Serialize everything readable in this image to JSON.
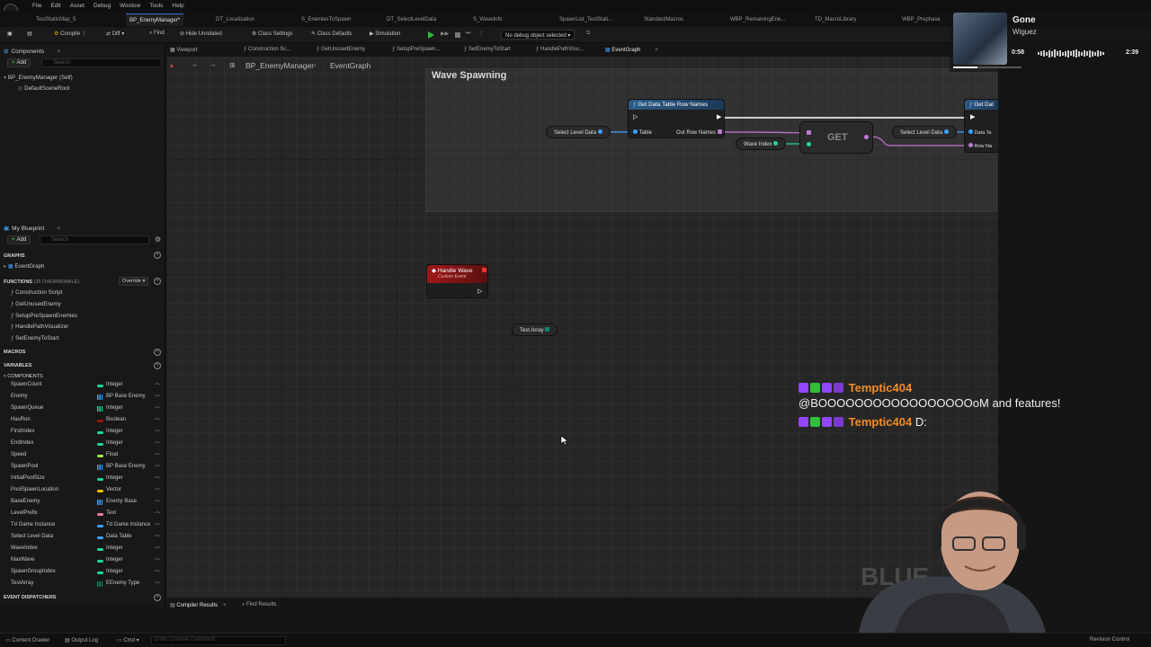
{
  "menu": [
    "File",
    "Edit",
    "Asset",
    "Debug",
    "Window",
    "Tools",
    "Help"
  ],
  "doc_tabs": [
    {
      "label": "TestStaticMap_5",
      "active": false
    },
    {
      "label": "BP_EnemyManager*",
      "active": true
    },
    {
      "label": "DT_Localization",
      "active": false
    },
    {
      "label": "S_EnemiesToSpawn",
      "active": false
    },
    {
      "label": "DT_SelectLevelData",
      "active": false
    },
    {
      "label": "S_WaveInfo",
      "active": false
    },
    {
      "label": "SpawnList_TestStati...",
      "active": false
    },
    {
      "label": "StandardMacros",
      "active": false
    },
    {
      "label": "WBP_RemainingEne...",
      "active": false
    },
    {
      "label": "TD_MacroLibrary",
      "active": false
    },
    {
      "label": "WBP_Prephase",
      "active": false
    }
  ],
  "toolbar": {
    "compile": "Compile",
    "diff": "Diff",
    "find": "Find",
    "hide_unrelated": "Hide Unrelated",
    "class_settings": "Class Settings",
    "class_defaults": "Class Defaults",
    "simulation": "Simulation",
    "debug_object": "No debug object selected"
  },
  "components_panel": {
    "tab": "Components",
    "add": "Add",
    "search_placeholder": "Search",
    "root": "BP_EnemyManager (Self)",
    "child": "DefaultSceneRoot"
  },
  "my_blueprint": {
    "tab": "My Blueprint",
    "add": "Add",
    "search_placeholder": "Search",
    "graphs_header": "Graphs",
    "event_graph": "EventGraph",
    "functions_header": "Functions",
    "functions_count": "(25 OVERRIDABLE)",
    "override": "Override",
    "functions": [
      "Construction Script",
      "GetUnusedEnemy",
      "SetupPreSpawnEnemies",
      "HandlePathVisualizer",
      "SetEnemyToStart"
    ],
    "macros_header": "Macros",
    "variables_header": "Variables",
    "components_header": "Components",
    "dispatchers_header": "Event Dispatchers",
    "variables": [
      {
        "name": "SpawnCount",
        "type": "Integer",
        "color": "#1fd6a0",
        "array": false
      },
      {
        "name": "Enemy",
        "type": "BP Base Enemy",
        "color": "#3aa2ff",
        "array": true
      },
      {
        "name": "SpawnQueue",
        "type": "Integer",
        "color": "#1fd6a0",
        "array": true
      },
      {
        "name": "HasRun",
        "type": "Boolean",
        "color": "#a01010",
        "array": false
      },
      {
        "name": "FirstIndex",
        "type": "Integer",
        "color": "#1fd6a0",
        "array": false
      },
      {
        "name": "EndIndex",
        "type": "Integer",
        "color": "#1fd6a0",
        "array": false
      },
      {
        "name": "Speed",
        "type": "Float",
        "color": "#9aef4a",
        "array": false
      },
      {
        "name": "SpawnPool",
        "type": "BP Base Enemy",
        "color": "#3aa2ff",
        "array": true
      },
      {
        "name": "InitialPoolSize",
        "type": "Integer",
        "color": "#1fd6a0",
        "array": false
      },
      {
        "name": "PoolSpawnLocation",
        "type": "Vector",
        "color": "#f5c300",
        "array": false
      },
      {
        "name": "BaseEnemy",
        "type": "Enemy Base",
        "color": "#3aa2ff",
        "array": true
      },
      {
        "name": "LevelPrefix",
        "type": "Text",
        "color": "#e87aa8",
        "array": false
      },
      {
        "name": "Td Game Instance",
        "type": "Td Game Instance",
        "color": "#3aa2ff",
        "array": false
      },
      {
        "name": "Select Level Data",
        "type": "Data Table",
        "color": "#3aa2ff",
        "array": false
      },
      {
        "name": "WaveIndex",
        "type": "Integer",
        "color": "#1fd6a0",
        "array": false
      },
      {
        "name": "MaxWave",
        "type": "Integer",
        "color": "#1fd6a0",
        "array": false
      },
      {
        "name": "SpawnGroupIndex",
        "type": "Integer",
        "color": "#1fd6a0",
        "array": false
      },
      {
        "name": "TestArray",
        "type": "EEnemy Type",
        "color": "#0a8a6a",
        "array": true
      }
    ]
  },
  "graph_tabs": [
    "Viewport",
    "Construction Sc...",
    "GetUnusedEnemy",
    "SetupPreSpawn...",
    "SetEnemyToStart",
    "HandlePathVisu...",
    "EventGraph"
  ],
  "breadcrumb": {
    "root": "BP_EnemyManager",
    "current": "EventGraph"
  },
  "graph": {
    "comment": "Wave Spawning",
    "get_row_names": {
      "title": "Get Data Table Row Names",
      "pin_table": "Table",
      "pin_out": "Out Row Names"
    },
    "select_level_data_1": "Select Level Data",
    "select_level_data_2": "Select Level Data",
    "wave_index": "Wave Index",
    "get_label": "GET",
    "cut_node_title": "Get Dat",
    "cut_pin_1": "Data Ta",
    "cut_pin_2": "Row Na",
    "handle_wave_title": "Handle Wave",
    "handle_wave_sub": "Custom Event",
    "test_array": "Test Array"
  },
  "bottom_tabs": {
    "compiler": "Compiler Results",
    "find": "Find Results"
  },
  "statusbar": {
    "content_drawer": "Content Drawer",
    "output_log": "Output Log",
    "cmd": "Cmd",
    "console_placeholder": "Enter Console Command",
    "revision": "Revision Control"
  },
  "music": {
    "title": "Gone",
    "artist": "Wiguez",
    "elapsed": "0:58",
    "total": "2:39",
    "progress": 0.36
  },
  "chat": [
    {
      "user": "Temptic404",
      "message": "@BOOOOOOOOOOOOOOOOOoM and features!"
    },
    {
      "user": "Temptic404",
      "message": "D:"
    }
  ],
  "watermark": "BLUE",
  "colors": {
    "accent_blue": "#3a6fd0",
    "exec_white": "#ffffff",
    "custom_event_red": "#a01818",
    "pure_green": "#2a7a4a",
    "chat_user": "#f28c28"
  }
}
